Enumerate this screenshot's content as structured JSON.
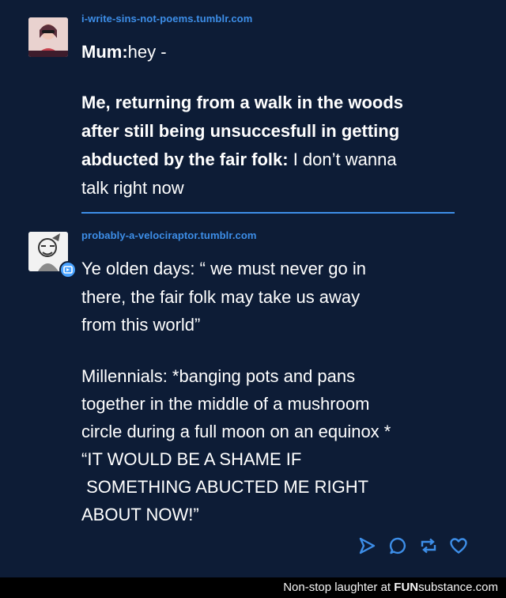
{
  "post1": {
    "username": "i-write-sins-not-poems.tumblr.com",
    "lines": [
      {
        "bold": "Mum:",
        "normal": "hey -"
      },
      {
        "bold": "Me, returning from a walk in the woods",
        "normal": ""
      },
      {
        "bold": "after still being unsuccesfull in getting",
        "normal": ""
      },
      {
        "bold": "abducted by the fair folk:",
        "normal": " I don’t wanna"
      },
      {
        "bold": "",
        "normal": "talk right now"
      }
    ]
  },
  "post2": {
    "username": "probably-a-velociraptor.tumblr.com",
    "lines": [
      "Ye olden days: “ we must never go in",
      "there, the fair folk may take us away",
      "from this world”",
      "Millennials: *banging pots and pans",
      "together in the middle of a mushroom",
      "circle during a full moon on an equinox *",
      "“IT WOULD BE A SHAME IF",
      " SOMETHING ABUCTED ME RIGHT",
      "ABOUT NOW!”"
    ]
  },
  "actions": [
    "share-icon",
    "reply-icon",
    "reblog-icon",
    "like-icon"
  ],
  "colors": {
    "background": "#0d1c36",
    "accent": "#3d8ee8",
    "footer": "#000000"
  },
  "footer": {
    "prefix": "Non-stop laughter at ",
    "brand_fun": "FUN",
    "brand_rest": "substance.com"
  }
}
